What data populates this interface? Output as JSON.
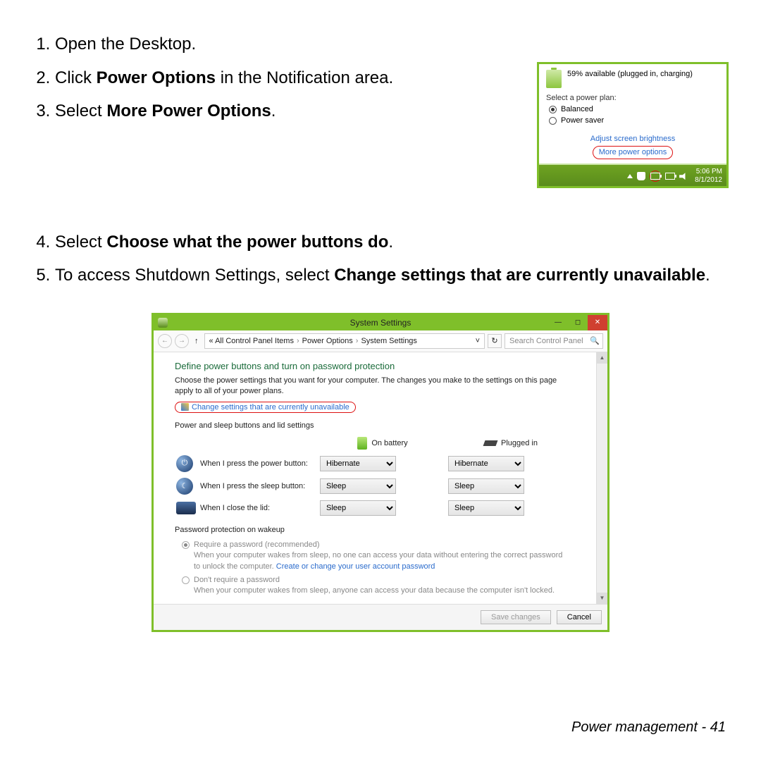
{
  "steps": {
    "s1": "Open the Desktop.",
    "s2a": "Click ",
    "s2b": "Power Options",
    "s2c": " in the Notification area.",
    "s3a": "Select ",
    "s3b": "More Power Options",
    "s3c": ".",
    "s4a": "Select ",
    "s4b": "Choose what the power buttons do",
    "s4c": ".",
    "s5a": "To access Shutdown Settings, select ",
    "s5b": "Change settings that are currently unavailable",
    "s5c": "."
  },
  "popup": {
    "status": "59% available (plugged in, charging)",
    "plan_head": "Select a power plan:",
    "plan1": "Balanced",
    "plan2": "Power saver",
    "link1": "Adjust screen brightness",
    "link2": "More power options",
    "time": "5:06 PM",
    "date": "8/1/2012"
  },
  "win": {
    "title": "System Settings",
    "crumb_pre": "«  All Control Panel Items",
    "crumb2": "Power Options",
    "crumb3": "System Settings",
    "search_ph": "Search Control Panel",
    "h3": "Define power buttons and turn on password protection",
    "desc": "Choose the power settings that you want for your computer. The changes you make to the settings on this page apply to all of your power plans.",
    "change": "Change settings that are currently unavailable",
    "sect1": "Power and sleep buttons and lid settings",
    "col1": "On battery",
    "col2": "Plugged in",
    "row1": "When I press the power button:",
    "row2": "When I press the sleep button:",
    "row3": "When I close the lid:",
    "opts": {
      "hib": "Hibernate",
      "sleep": "Sleep"
    },
    "sect2": "Password protection on wakeup",
    "pw1_label": "Require a password (recommended)",
    "pw1_text": "When your computer wakes from sleep, no one can access your data without entering the correct password to unlock the computer. ",
    "pw1_link": "Create or change your user account password",
    "pw2_label": "Don't require a password",
    "pw2_text": "When your computer wakes from sleep, anyone can access your data because the computer isn't locked.",
    "save": "Save changes",
    "cancel": "Cancel"
  },
  "footer": {
    "label": "Power management - ",
    "page": "41"
  }
}
